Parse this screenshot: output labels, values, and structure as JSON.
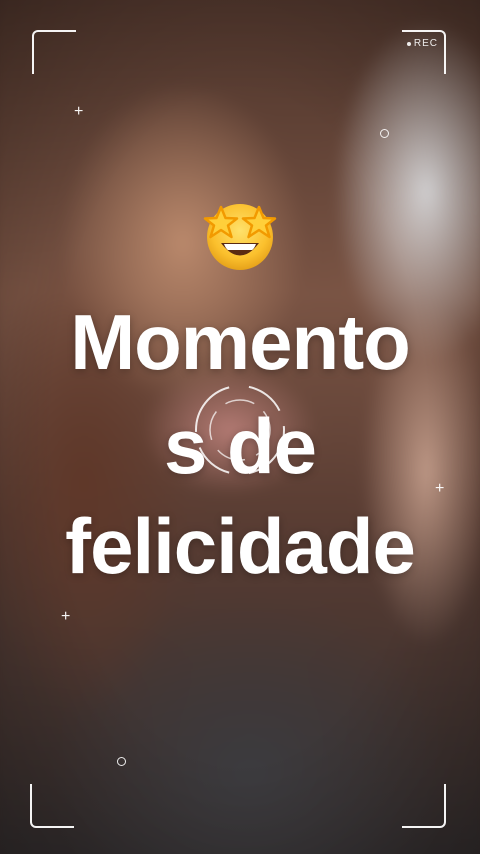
{
  "recording": {
    "label": "REC"
  },
  "caption": {
    "line1": "Momento",
    "line2": "s de",
    "line3": "felicidade"
  },
  "stickers": {
    "emoji": "star-struck-emoji-icon"
  },
  "overlay": {
    "frame": "camera-viewfinder-frame",
    "focus": "focus-ring-icon"
  }
}
